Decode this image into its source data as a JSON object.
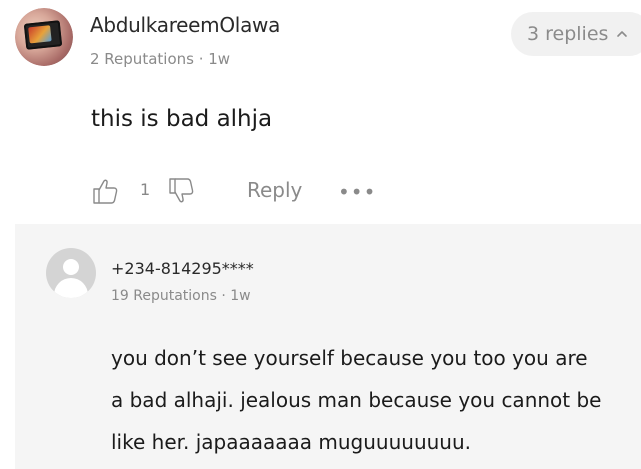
{
  "comment": {
    "username": "AbdulkareemOlawa",
    "meta": "2 Reputations · 1w",
    "text": "this is bad alhja",
    "replies_label": "3 replies",
    "like_count": "1",
    "reply_label": "Reply",
    "more_label": "•••"
  },
  "reply": {
    "username": "+234-814295****",
    "meta": "19 Reputations · 1w",
    "lines": [
      "you don’t see yourself because you too you are",
      "a bad alhaji. jealous man because you cannot be",
      "like her. japaaaaaaa muguuuuuuuu."
    ]
  },
  "icons": {
    "like": "thumbs-up-icon",
    "dislike": "thumbs-down-icon",
    "chevron": "chevron-up-icon",
    "more": "more-dots-icon",
    "default_avatar": "default-user-icon"
  }
}
